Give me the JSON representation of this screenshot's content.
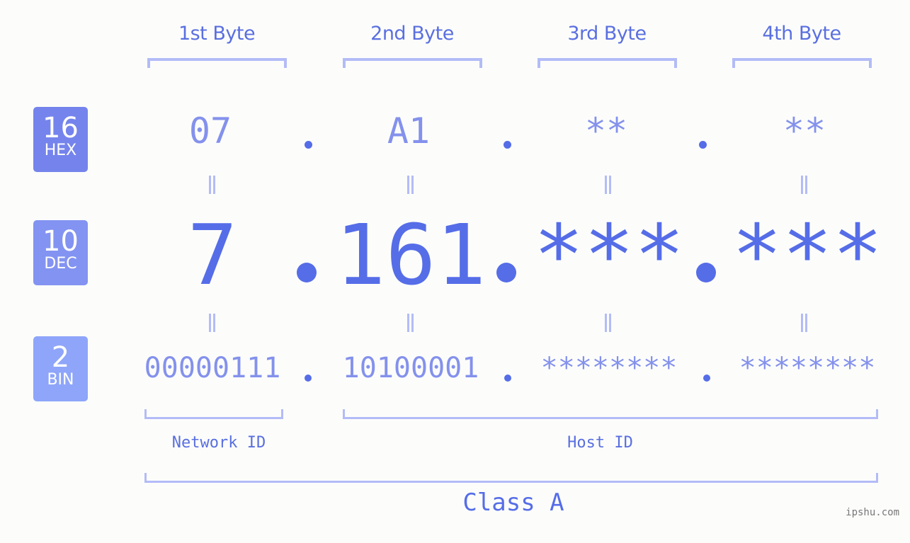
{
  "byte_headers": [
    "1st Byte",
    "2nd Byte",
    "3rd Byte",
    "4th Byte"
  ],
  "badges": {
    "hex": {
      "number": "16",
      "label": "HEX",
      "color": "#7584ec"
    },
    "dec": {
      "number": "10",
      "label": "DEC",
      "color": "#8393f1"
    },
    "bin": {
      "number": "2",
      "label": "BIN",
      "color": "#8ea5f9"
    }
  },
  "hex_values": [
    "07",
    "A1",
    "**",
    "**"
  ],
  "dec_values": [
    "7",
    "161",
    "***",
    "***"
  ],
  "bin_values": [
    "00000111",
    "10100001",
    "********",
    "********"
  ],
  "sections": {
    "network_id": "Network ID",
    "host_id": "Host ID",
    "class": "Class A"
  },
  "watermark": "ipshu.com",
  "colors": {
    "accent": "#566de8",
    "bracket": "#b3bcf7",
    "light_text": "#8491ec"
  }
}
